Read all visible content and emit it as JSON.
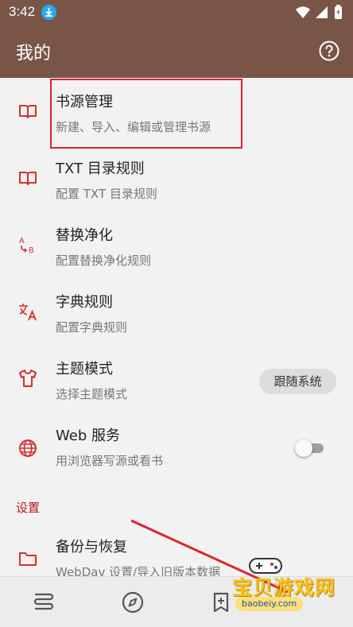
{
  "status_bar": {
    "time": "3:42"
  },
  "app_bar": {
    "title": "我的"
  },
  "items": [
    {
      "title": "书源管理",
      "subtitle": "新建、导入、编辑或管理书源"
    },
    {
      "title": "TXT 目录规则",
      "subtitle": "配置 TXT 目录规则"
    },
    {
      "title": "替换净化",
      "subtitle": "配置替换净化规则"
    },
    {
      "title": "字典规则",
      "subtitle": "配置字典规则"
    },
    {
      "title": "主题模式",
      "subtitle": "选择主题模式",
      "value": "跟随系统"
    },
    {
      "title": "Web 服务",
      "subtitle": "用浏览器写源或看书",
      "enabled": false
    },
    {
      "title": "备份与恢复",
      "subtitle": "WebDav 设置/导入旧版本数据"
    }
  ],
  "settings_section": {
    "label": "设置"
  },
  "watermark": {
    "name": "宝贝游戏网",
    "url": "baobeiy.com"
  },
  "colors": {
    "primary": "#795548",
    "accent": "#d32f2f",
    "annotation": "#d9262f"
  },
  "icons": {
    "item_0": "book-icon",
    "item_1": "book-icon",
    "item_2": "replace-icon",
    "item_3": "translate-icon",
    "item_4": "tshirt-icon",
    "item_5": "globe-icon",
    "item_6": "folder-icon",
    "nav": [
      "bookshelf-icon",
      "explore-icon",
      "rss-icon"
    ]
  }
}
